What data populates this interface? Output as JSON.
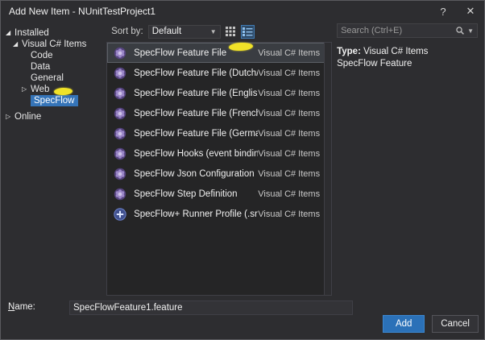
{
  "window": {
    "title": "Add New Item - NUnitTestProject1",
    "help_label": "?",
    "close_label": "✕"
  },
  "sidebar": {
    "items": [
      {
        "label": "Installed",
        "state": "expanded"
      },
      {
        "label": "Visual C# Items",
        "state": "expanded"
      },
      {
        "label": "Code",
        "state": "none"
      },
      {
        "label": "Data",
        "state": "none"
      },
      {
        "label": "General",
        "state": "none"
      },
      {
        "label": "Web",
        "state": "collapsed"
      },
      {
        "label": "SpecFlow",
        "state": "selected"
      },
      {
        "label": "Online",
        "state": "collapsed"
      }
    ]
  },
  "toolbar": {
    "sort_label": "Sort by:",
    "sort_value": "Default"
  },
  "search": {
    "placeholder": "Search (Ctrl+E)"
  },
  "list": {
    "items": [
      {
        "label": "SpecFlow Feature File",
        "type": "Visual C# Items",
        "selected": true
      },
      {
        "label": "SpecFlow Feature File (Dutch/Nederlands)",
        "type": "Visual C# Items"
      },
      {
        "label": "SpecFlow Feature File (English)",
        "type": "Visual C# Items"
      },
      {
        "label": "SpecFlow Feature File (French/français)",
        "type": "Visual C# Items"
      },
      {
        "label": "SpecFlow Feature File (German/Deutsch)",
        "type": "Visual C# Items"
      },
      {
        "label": "SpecFlow Hooks (event bindings)",
        "type": "Visual C# Items"
      },
      {
        "label": "SpecFlow Json Configuration",
        "type": "Visual C# Items"
      },
      {
        "label": "SpecFlow Step Definition",
        "type": "Visual C# Items"
      },
      {
        "label": "SpecFlow+ Runner Profile (.srprofile)",
        "type": "Visual C# Items"
      }
    ]
  },
  "details": {
    "type_label": "Type:",
    "type_value": "Visual C# Items",
    "description": "SpecFlow Feature"
  },
  "footer": {
    "name_mnemonic": "N",
    "name_rest": "ame:",
    "name_value": "SpecFlowFeature1.feature",
    "add_label": "Add",
    "cancel_label": "Cancel"
  },
  "colors": {
    "accent_blue": "#2b71b8",
    "tree_selection": "#3574b8",
    "annotation_yellow": "#f0e228",
    "icon_purple": "#5a4886",
    "dialog_background": "#2d2d30",
    "list_background": "#252526"
  }
}
